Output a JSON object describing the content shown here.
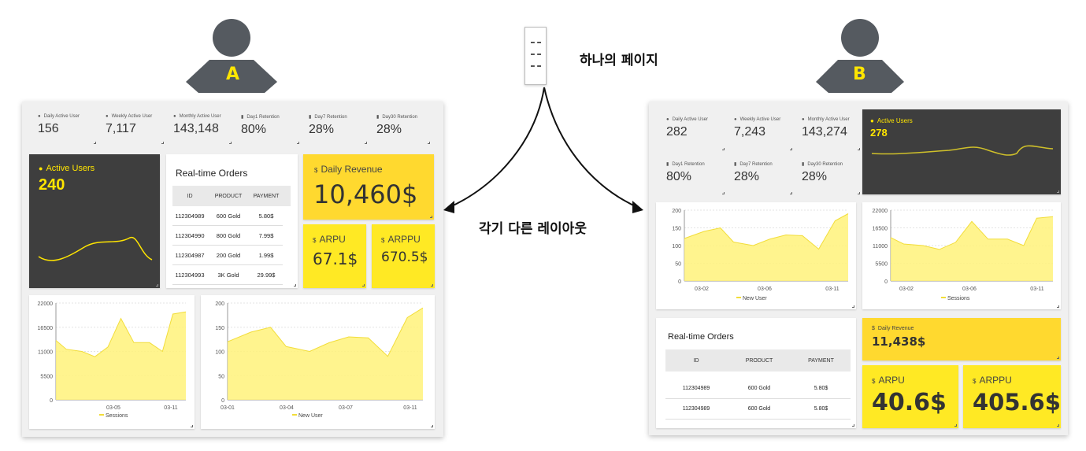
{
  "top": {
    "label": "하나의 페이지",
    "bottom_label": "각기 다른 레이아웃"
  },
  "user_a": {
    "letter": "A"
  },
  "user_b": {
    "letter": "B"
  },
  "colors": {
    "accent": "#ffe500",
    "dark": "#3e3e3e",
    "series": "#fff27a"
  },
  "layout_a": {
    "kpis": [
      {
        "icon": "user-icon",
        "label": "Daily Active User",
        "value": "156"
      },
      {
        "icon": "user-icon",
        "label": "Weekly Active User",
        "value": "7,117"
      },
      {
        "icon": "user-icon",
        "label": "Monthly Active User",
        "value": "143,148"
      },
      {
        "icon": "bar-chart-icon",
        "label": "Day1 Retention",
        "value": "80%"
      },
      {
        "icon": "bar-chart-icon",
        "label": "Day7 Retention",
        "value": "28%"
      },
      {
        "icon": "bar-chart-icon",
        "label": "Day30 Retention",
        "value": "28%"
      }
    ],
    "active_users": {
      "label": "Active Users",
      "value": "240"
    },
    "orders": {
      "title": "Real-time Orders",
      "headers": [
        "ID",
        "PRODUCT",
        "PAYMENT"
      ],
      "rows": [
        [
          "112304989",
          "600 Gold",
          "5.80$"
        ],
        [
          "112304990",
          "800 Gold",
          "7.99$"
        ],
        [
          "112304987",
          "200 Gold",
          "1.99$"
        ],
        [
          "112304993",
          "3K Gold",
          "29.99$"
        ]
      ]
    },
    "daily_revenue": {
      "icon": "$",
      "label": "Daily Revenue",
      "value": "10,460$"
    },
    "arpu": {
      "icon": "$",
      "label": "ARPU",
      "value": "67.1$"
    },
    "arppu": {
      "icon": "$",
      "label": "ARPPU",
      "value": "670.5$"
    },
    "sessions_chart": {
      "legend": "Sessions",
      "yticks": [
        "22000",
        "16500",
        "11000",
        "5500",
        "0"
      ],
      "xticks": [
        "03-05",
        "03-11"
      ]
    },
    "newuser_chart": {
      "legend": "New User",
      "yticks": [
        "200",
        "150",
        "100",
        "50",
        "0"
      ],
      "xticks": [
        "03-01",
        "03-04",
        "03-07",
        "03-11"
      ]
    }
  },
  "layout_b": {
    "kpis": [
      {
        "icon": "user-icon",
        "label": "Daily Active User",
        "value": "282"
      },
      {
        "icon": "user-icon",
        "label": "Weekly Active User",
        "value": "7,243"
      },
      {
        "icon": "user-icon",
        "label": "Monthly Active User",
        "value": "143,274"
      },
      {
        "icon": "bar-chart-icon",
        "label": "Day1 Retention",
        "value": "80%"
      },
      {
        "icon": "bar-chart-icon",
        "label": "Day7 Retention",
        "value": "28%"
      },
      {
        "icon": "bar-chart-icon",
        "label": "Day30 Retention",
        "value": "28%"
      }
    ],
    "active_users": {
      "label": "Active Users",
      "value": "278"
    },
    "newuser_chart": {
      "legend": "New User",
      "yticks": [
        "200",
        "150",
        "100",
        "50",
        "0"
      ],
      "xticks": [
        "03-02",
        "03-06",
        "03-11"
      ]
    },
    "sessions_chart": {
      "legend": "Sessions",
      "yticks": [
        "22000",
        "16500",
        "11000",
        "5500",
        "0"
      ],
      "xticks": [
        "03-02",
        "03-06",
        "03-11"
      ]
    },
    "orders": {
      "title": "Real-time Orders",
      "headers": [
        "ID",
        "PRODUCT",
        "PAYMENT"
      ],
      "rows": [
        [
          "112304989",
          "600 Gold",
          "5.80$"
        ],
        [
          "112304989",
          "600 Gold",
          "5.80$"
        ]
      ]
    },
    "daily_revenue": {
      "icon": "$",
      "label": "Daily Revenue",
      "value": "11,438$"
    },
    "arpu": {
      "icon": "$",
      "label": "ARPU",
      "value": "40.6$"
    },
    "arppu": {
      "icon": "$",
      "label": "ARPPU",
      "value": "405.6$"
    }
  }
}
